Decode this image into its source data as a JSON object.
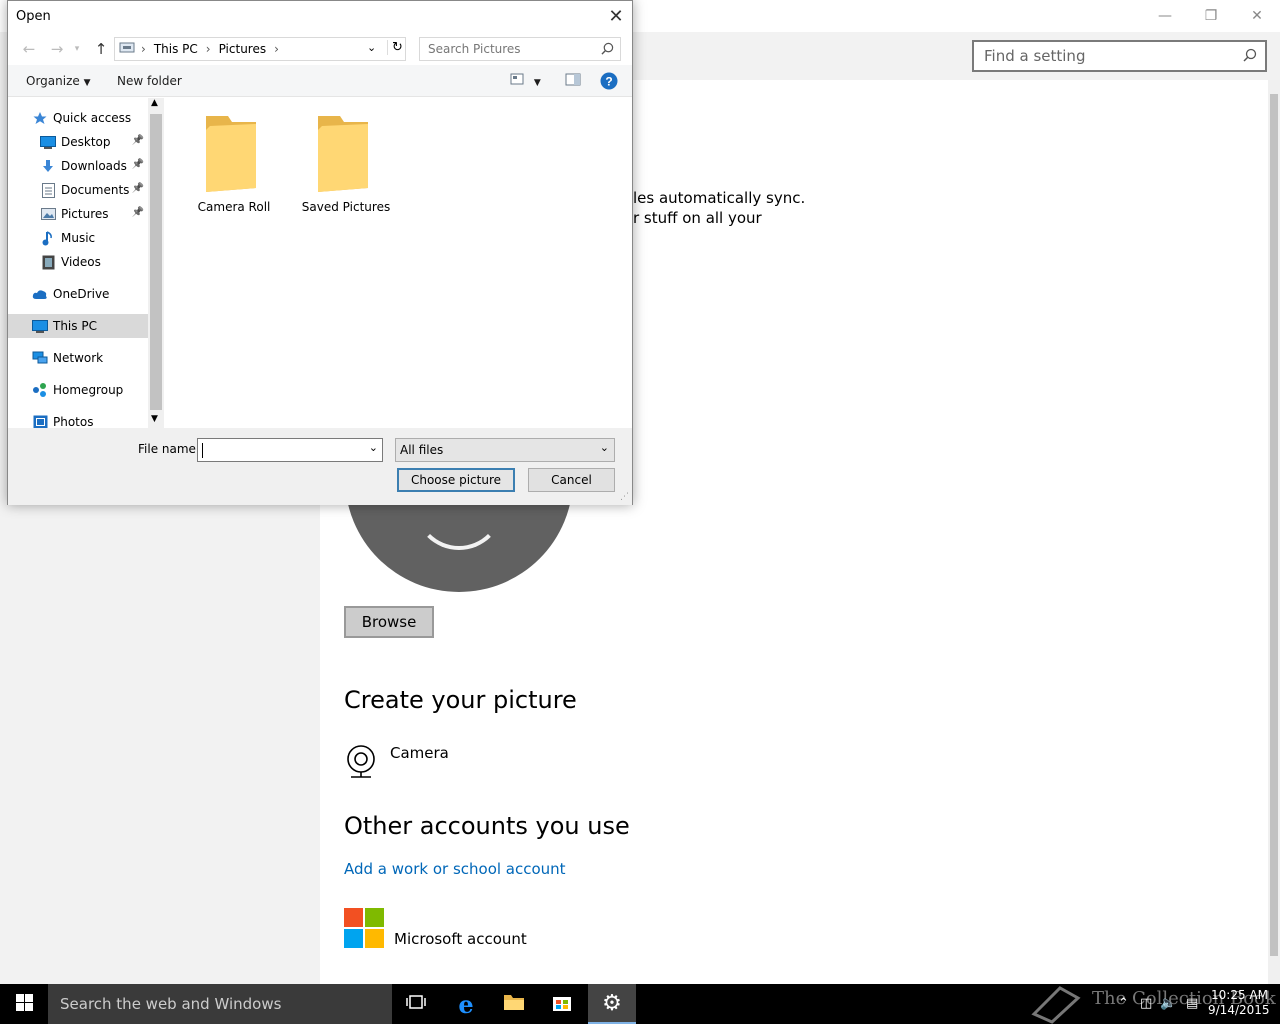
{
  "settings": {
    "search_placeholder": "Find a setting",
    "sync_line1": "les automatically sync.",
    "sync_line2": "r stuff on all your",
    "browse_label": "Browse",
    "create_title": "Create your picture",
    "camera_label": "Camera",
    "other_title": "Other accounts you use",
    "add_account": "Add a work or school account",
    "ms_account": "Microsoft account",
    "ms_colors": [
      "#f25022",
      "#7fba00",
      "#00a4ef",
      "#ffb900"
    ]
  },
  "dialog": {
    "title": "Open",
    "breadcrumb": [
      "This PC",
      "Pictures"
    ],
    "search_placeholder": "Search Pictures",
    "organize": "Organize",
    "new_folder": "New folder",
    "nav": [
      {
        "label": "Quick access",
        "icon": "star-icon",
        "indent": 0
      },
      {
        "label": "Desktop",
        "icon": "desktop-icon",
        "indent": 1,
        "pinned": true
      },
      {
        "label": "Downloads",
        "icon": "download-icon",
        "indent": 1,
        "pinned": true
      },
      {
        "label": "Documents",
        "icon": "documents-icon",
        "indent": 1,
        "pinned": true
      },
      {
        "label": "Pictures",
        "icon": "pictures-icon",
        "indent": 1,
        "pinned": true
      },
      {
        "label": "Music",
        "icon": "music-icon",
        "indent": 1
      },
      {
        "label": "Videos",
        "icon": "videos-icon",
        "indent": 1
      },
      {
        "label": "OneDrive",
        "icon": "cloud-icon",
        "indent": 0
      },
      {
        "label": "This PC",
        "icon": "computer-icon",
        "indent": 0,
        "selected": true
      },
      {
        "label": "Network",
        "icon": "network-icon",
        "indent": 0
      },
      {
        "label": "Homegroup",
        "icon": "homegroup-icon",
        "indent": 0
      },
      {
        "label": "Photos",
        "icon": "photos-icon",
        "indent": 0
      }
    ],
    "folders": [
      "Camera Roll",
      "Saved Pictures"
    ],
    "file_name_label": "File name:",
    "file_name_value": "",
    "filter_value": "All files",
    "choose_label": "Choose picture",
    "cancel_label": "Cancel"
  },
  "taskbar": {
    "search_placeholder": "Search the web and Windows",
    "watermark": "The Collection Book",
    "time": "10:25 AM",
    "date": "9/14/2015"
  }
}
